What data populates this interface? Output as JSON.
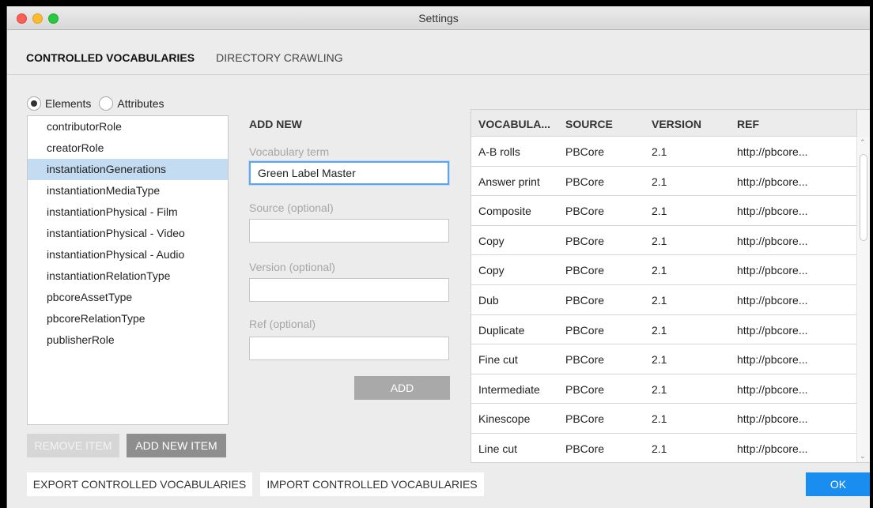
{
  "window": {
    "title": "Settings"
  },
  "tabs": [
    "CONTROLLED VOCABULARIES",
    "DIRECTORY CRAWLING"
  ],
  "radios": {
    "elements": "Elements",
    "attributes": "Attributes"
  },
  "list": {
    "items": [
      "contributorRole",
      "creatorRole",
      "instantiationGenerations",
      "instantiationMediaType",
      "instantiationPhysical - Film",
      "instantiationPhysical - Video",
      "instantiationPhysical - Audio",
      "instantiationRelationType",
      "pbcoreAssetType",
      "pbcoreRelationType",
      "publisherRole"
    ],
    "selected_index": 2
  },
  "buttons": {
    "remove_item": "REMOVE ITEM",
    "add_new_item": "ADD NEW ITEM",
    "export": "EXPORT CONTROLLED VOCABULARIES",
    "import": "IMPORT CONTROLLED VOCABULARIES",
    "ok": "OK",
    "add": "ADD"
  },
  "form": {
    "title": "ADD NEW",
    "vocab_label": "Vocabulary term",
    "vocab_value": "Green Label Master",
    "source_label": "Source (optional)",
    "source_value": "",
    "version_label": "Version (optional)",
    "version_value": "",
    "ref_label": "Ref (optional)",
    "ref_value": ""
  },
  "table": {
    "headers": [
      "VOCABULA...",
      "SOURCE",
      "VERSION",
      "REF"
    ],
    "rows": [
      [
        "A-B rolls",
        "PBCore",
        "2.1",
        "http://pbcore..."
      ],
      [
        "Answer print",
        "PBCore",
        "2.1",
        "http://pbcore..."
      ],
      [
        "Composite",
        "PBCore",
        "2.1",
        "http://pbcore..."
      ],
      [
        "Copy",
        "PBCore",
        "2.1",
        "http://pbcore..."
      ],
      [
        "Copy",
        "PBCore",
        "2.1",
        "http://pbcore..."
      ],
      [
        "Dub",
        "PBCore",
        "2.1",
        "http://pbcore..."
      ],
      [
        "Duplicate",
        "PBCore",
        "2.1",
        "http://pbcore..."
      ],
      [
        "Fine cut",
        "PBCore",
        "2.1",
        "http://pbcore..."
      ],
      [
        "Intermediate",
        "PBCore",
        "2.1",
        "http://pbcore..."
      ],
      [
        "Kinescope",
        "PBCore",
        "2.1",
        "http://pbcore..."
      ],
      [
        "Line cut",
        "PBCore",
        "2.1",
        "http://pbcore..."
      ]
    ]
  },
  "colors": {
    "accent": "#1a8ef0",
    "selection": "#c3dcf2"
  }
}
